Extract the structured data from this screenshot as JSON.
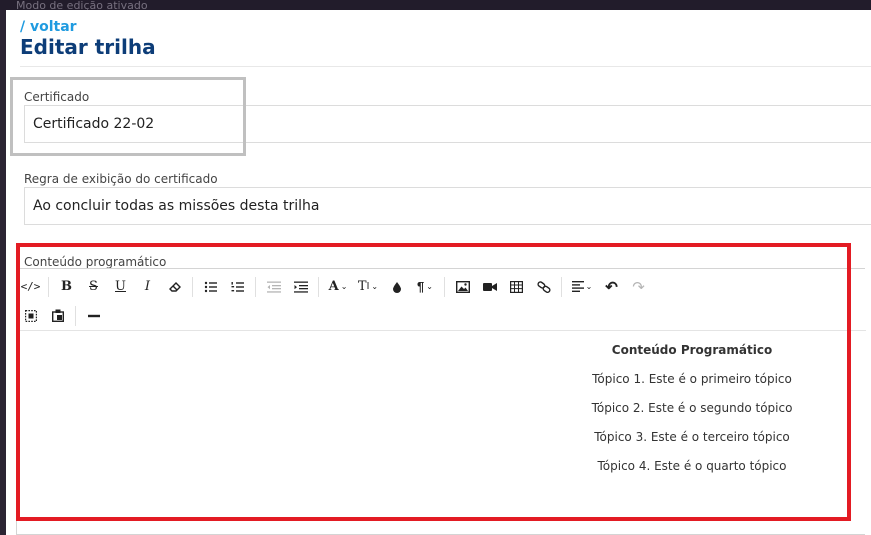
{
  "topbar": {
    "text": "Modo de edição ativado"
  },
  "header": {
    "back_label": "/ voltar",
    "title": "Editar trilha"
  },
  "fields": {
    "certificate": {
      "label": "Certificado",
      "value": "Certificado 22-02"
    },
    "display_rule": {
      "label": "Regra de exibição do certificado",
      "value": "Ao concluir todas as missões desta trilha"
    }
  },
  "editor": {
    "label": "Conteúdo programático",
    "toolbar_icons": [
      "code-view-icon",
      "bold-icon",
      "strikethrough-icon",
      "underline-icon",
      "italic-icon",
      "eraser-icon",
      "bullet-list-icon",
      "numbered-list-icon",
      "outdent-icon",
      "indent-icon",
      "font-family-icon",
      "font-size-icon",
      "color-icon",
      "paragraph-icon",
      "image-icon",
      "video-icon",
      "table-icon",
      "link-icon",
      "align-icon",
      "undo-icon",
      "redo-icon",
      "select-all-icon",
      "paste-icon",
      "horizontal-rule-icon"
    ],
    "content": {
      "heading": "Conteúdo Programático",
      "topics": [
        "Tópico 1. Este é o primeiro tópico",
        "Tópico 2. Este é o segundo tópico",
        "Tópico 3. Este é o terceiro tópico",
        "Tópico 4. Este é o quarto tópico"
      ]
    }
  },
  "highlights": {
    "red": "#e31b23",
    "gray": "#c0c0c0"
  }
}
